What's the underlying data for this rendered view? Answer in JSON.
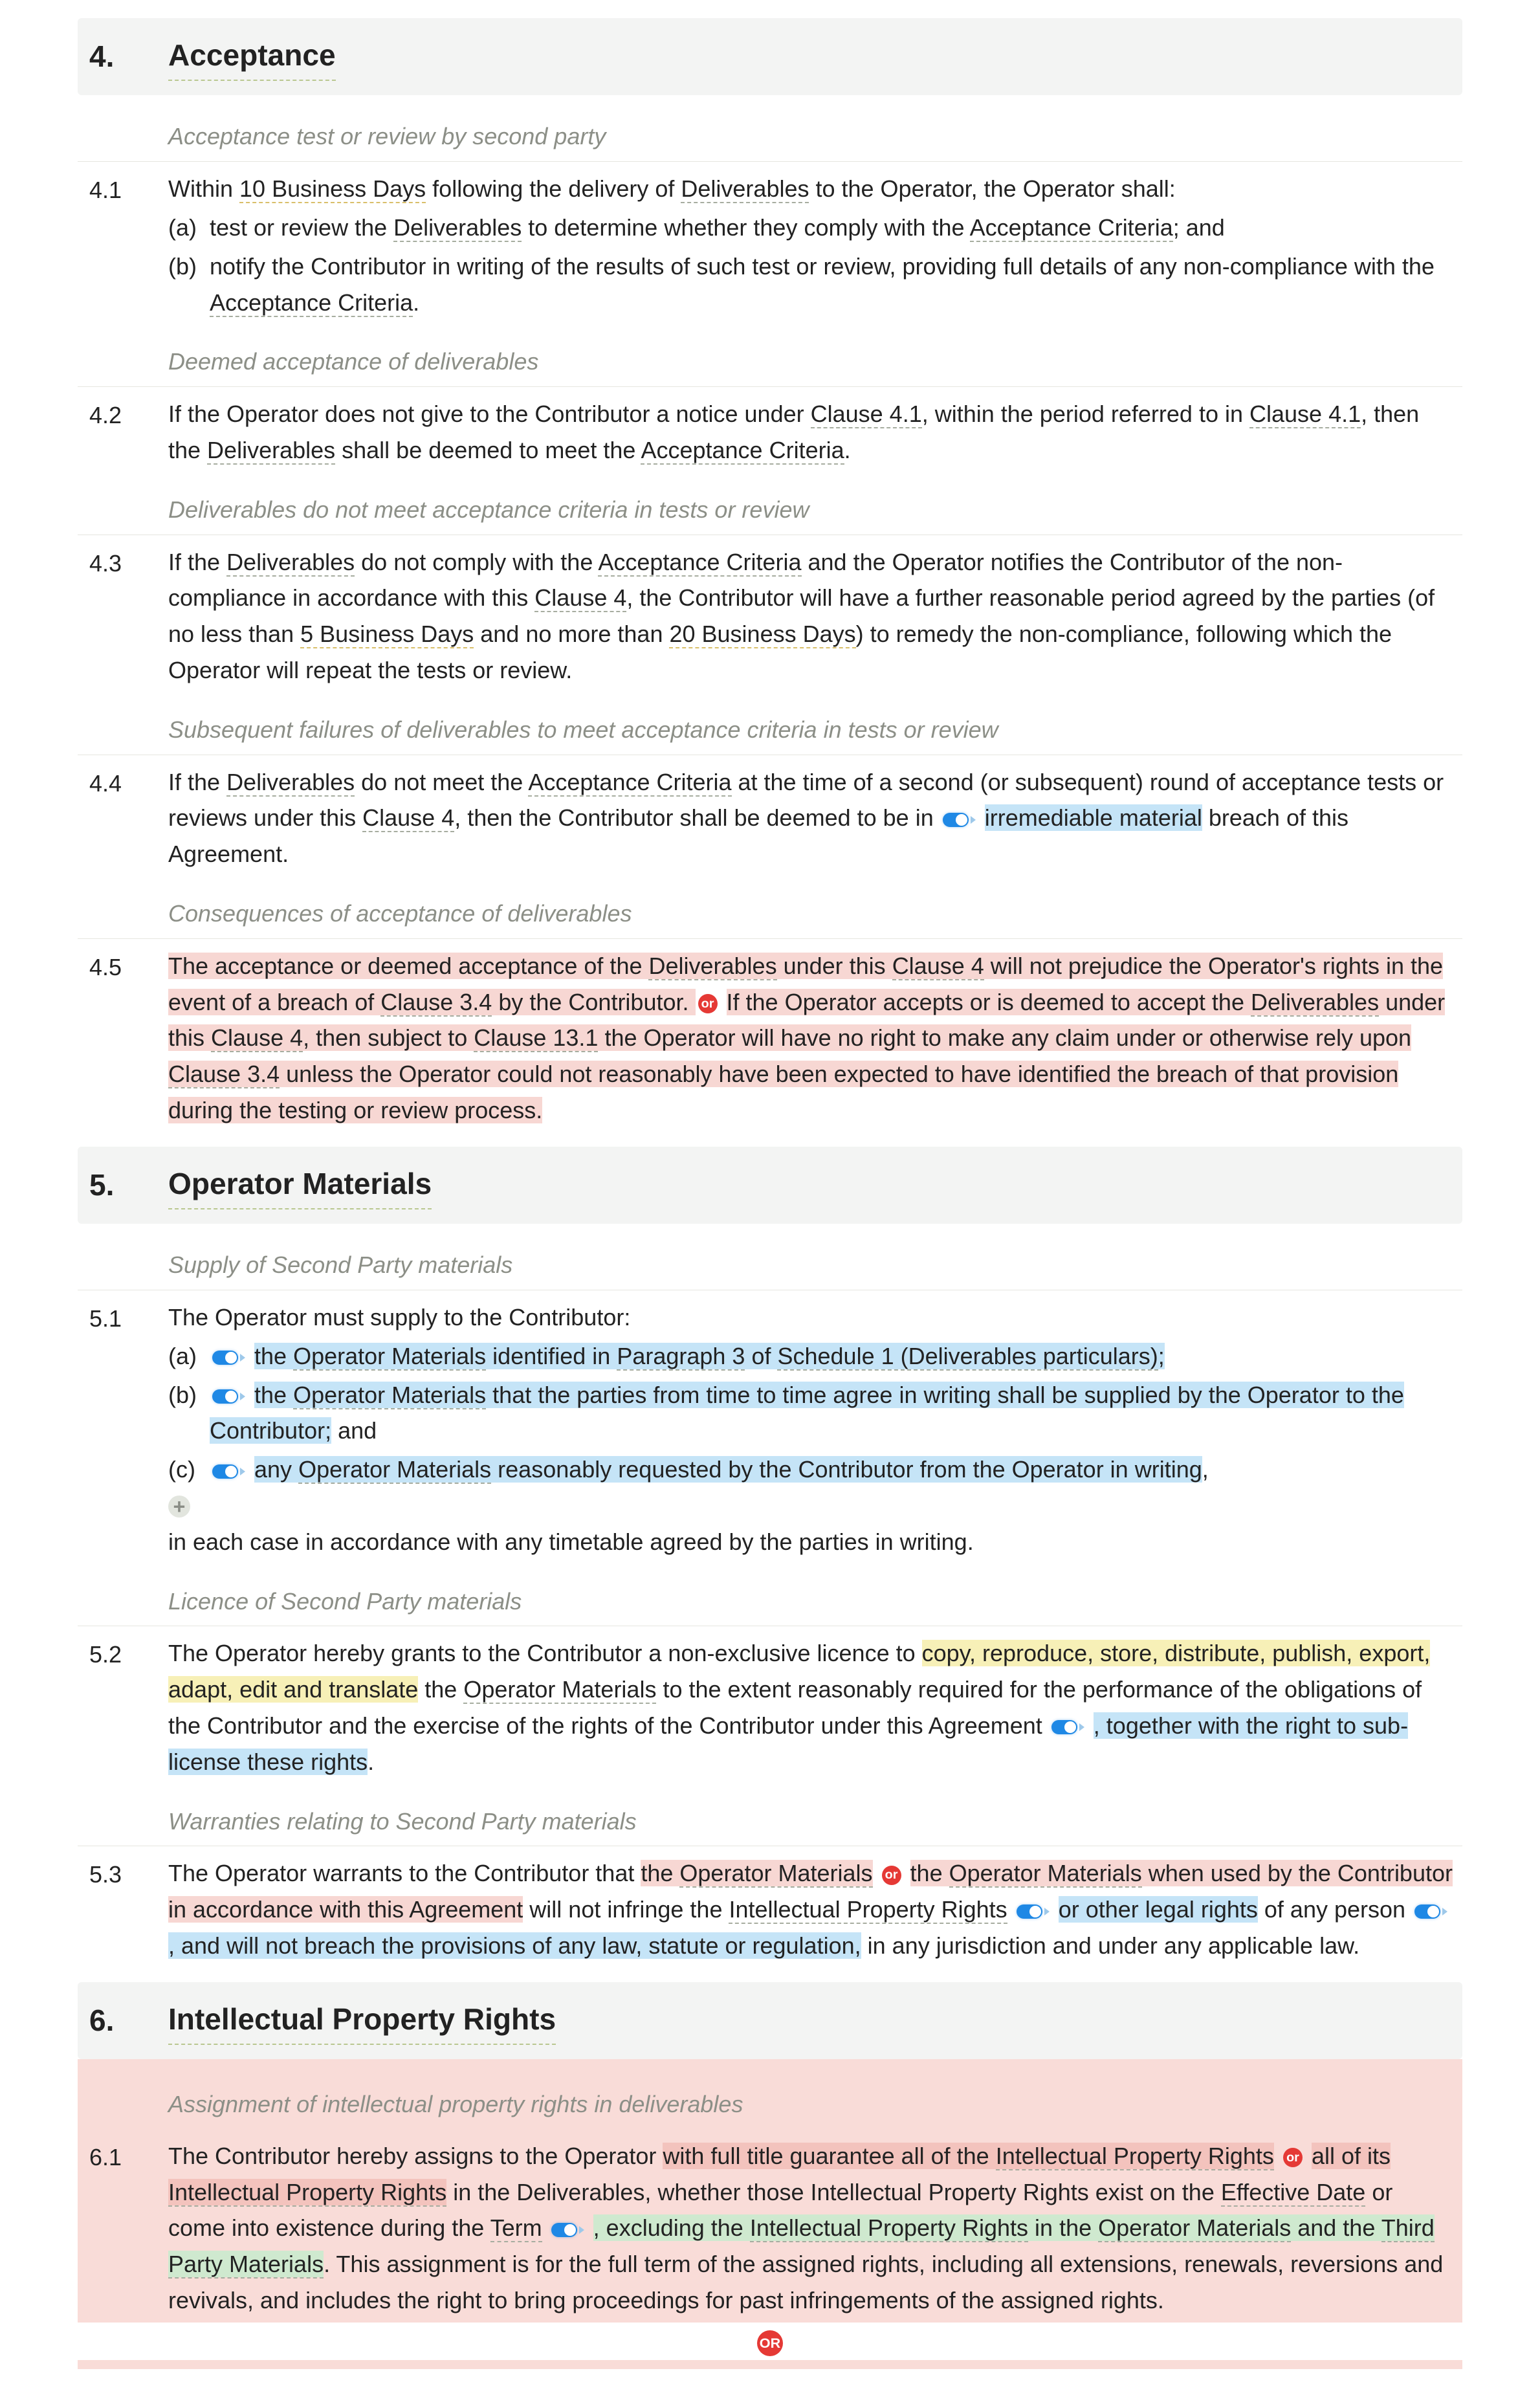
{
  "section4": {
    "num": "4.",
    "title": "Acceptance",
    "sub1": {
      "heading": "Acceptance test or review by second party",
      "num": "4.1",
      "lead_a": "Within ",
      "term1": "10 Business Days",
      "lead_b": " following the delivery of ",
      "term2": "Deliverables",
      "lead_c": " to the Operator, the Operator shall:",
      "a_marker": "(a)",
      "a_a": "test or review the ",
      "a_term": "Deliverables",
      "a_b": " to determine whether they comply with the ",
      "a_term2": "Acceptance Criteria",
      "a_c": "; and",
      "b_marker": "(b)",
      "b_a": "notify the Contributor in writing of the results of such test or review, providing full details of any non-compliance with the ",
      "b_term": "Acceptance Criteria",
      "b_b": "."
    },
    "sub2": {
      "heading": "Deemed acceptance of deliverables",
      "num": "4.2",
      "a": "If the Operator does not give to the Contributor a notice under ",
      "t1": "Clause 4.1",
      "b": ", within the period referred to in ",
      "t2": "Clause 4.1",
      "c": ", then the ",
      "t3": "Deliverables",
      "d": " shall be deemed to meet the ",
      "t4": "Acceptance Criteria",
      "e": "."
    },
    "sub3": {
      "heading": "Deliverables do not meet acceptance criteria in tests or review",
      "num": "4.3",
      "a": "If the ",
      "t1": "Deliverables",
      "b": " do not comply with the ",
      "t2": "Acceptance Criteria",
      "c": " and the Operator notifies the Contributor of the non-compliance in accordance with this ",
      "t3": "Clause 4",
      "d": ", the Contributor will have a further reasonable period agreed by the parties (of no less than ",
      "t4": "5 Business Days",
      "e": " and no more than ",
      "t5": "20 Business Days",
      "f": ") to remedy the non-compliance, following which the Operator will repeat the tests or review."
    },
    "sub4": {
      "heading": "Subsequent failures of deliverables to meet acceptance criteria in tests or review",
      "num": "4.4",
      "a": "If the ",
      "t1": "Deliverables",
      "b": " do not meet the ",
      "t2": "Acceptance Criteria",
      "c": " at the time of a second (or subsequent) round of acceptance tests or reviews under this ",
      "t3": "Clause 4",
      "d": ", then the Contributor shall be deemed to be in ",
      "hl": "irremediable material",
      "e": " breach of this Agreement."
    },
    "sub5": {
      "heading": "Consequences of acceptance of deliverables",
      "num": "4.5",
      "p1a": "The acceptance or deemed acceptance of the ",
      "t1": "Deliverables",
      "p1b": " under this ",
      "t2": "Clause 4",
      "p1c": " will not prejudice the Operator's rights in the event of a breach of ",
      "t3": "Clause 3.4",
      "p1d": " by the Contributor.",
      "or": "or",
      "p2a": "If the Operator accepts or is deemed to accept the ",
      "t4": "Deliverables",
      "p2b": " under this ",
      "t5": "Clause 4",
      "p2c": ", then subject to ",
      "t6": "Clause 13.1",
      "p2d": " the Operator will have no right to make any claim under or otherwise rely upon ",
      "t7": "Clause 3.4",
      "p2e": " unless the Operator could not reasonably have been expected to have identified the breach of that provision during the testing or review process."
    }
  },
  "section5": {
    "num": "5.",
    "title": "Operator Materials",
    "sub1": {
      "heading": "Supply of Second Party materials",
      "num": "5.1",
      "lead": "The Operator must supply to the Contributor:",
      "a_marker": "(a)",
      "b_marker": "(b)",
      "c_marker": "(c)",
      "a_a": "the ",
      "a_t": "Operator Materials",
      "a_b": " identified in ",
      "a_t2": "Paragraph 3",
      "a_c": " of ",
      "a_t3": "Schedule 1 (Deliverables particulars)",
      "a_d": ";",
      "b_a": "the ",
      "b_t": "Operator Materials",
      "b_b": " that the parties from time to time agree in writing shall be supplied by the Operator to the Contributor;",
      "b_and": " and",
      "c_a": "any ",
      "c_t": "Operator Materials",
      "c_b": " reasonably requested by the Contributor from the Operator in writing",
      "c_c": ",",
      "plus": "+",
      "tail": "in each case in accordance with any timetable agreed by the parties in writing."
    },
    "sub2": {
      "heading": "Licence of Second Party materials",
      "num": "5.2",
      "a": "The Operator hereby grants to the Contributor a non-exclusive licence to ",
      "hlY": "copy, reproduce, store, distribute, publish, export, adapt, edit and translate",
      "b": " the ",
      "t1": "Operator Materials",
      "c": " to the extent reasonably required for the performance of the obligations of the Contributor and the exercise of the rights of the Contributor under this Agreement ",
      "hlB": ", together with the right to sub-license these rights",
      "d": "."
    },
    "sub3": {
      "heading": "Warranties relating to Second Party materials",
      "num": "5.3",
      "a": "The Operator warrants to the Contributor that ",
      "pA": "the ",
      "pAt": "Operator Materials",
      "or": "or",
      "pB": "the ",
      "pBt": "Operator Materials",
      "pBb": " when used by the Contributor in accordance with this Agreement",
      "c": " will not infringe the ",
      "t2": "Intellectual Property Rights",
      "hlB1": "or other legal rights",
      "d": " of any person ",
      "hlB2": ", and will not breach the provisions of any law, statute or regulation,",
      "e": " in any jurisdiction and under any applicable law."
    }
  },
  "section6": {
    "num": "6.",
    "title": "Intellectual Property Rights",
    "sub1": {
      "heading": "Assignment of intellectual property rights in deliverables",
      "num": "6.1",
      "a": "The Contributor hereby assigns to the Operator ",
      "pA": "with full title guarantee all of the ",
      "pAt": "Intellectual Property Rights",
      "or": "or",
      "pB": "all of its ",
      "pBt": "Intellectual Property Rights",
      "b": " in the Deliverables, whether those Intellectual Property Rights exist on the ",
      "t1": "Effective Date",
      "c": " or come into existence during the ",
      "t2": "Term",
      "hlG": ", excluding the ",
      "hlGt1": "Intellectual Property Rights",
      "hlGm": " in the ",
      "hlGt2": "Operator Materials",
      "hlGm2": " and the ",
      "hlGt3": "Third Party Materials",
      "d": ". This assignment is for the full term of the assigned rights, including all extensions, renewals, reversions and revivals, and includes the right to bring proceedings for past infringements of the assigned rights.",
      "orBig": "OR"
    }
  }
}
